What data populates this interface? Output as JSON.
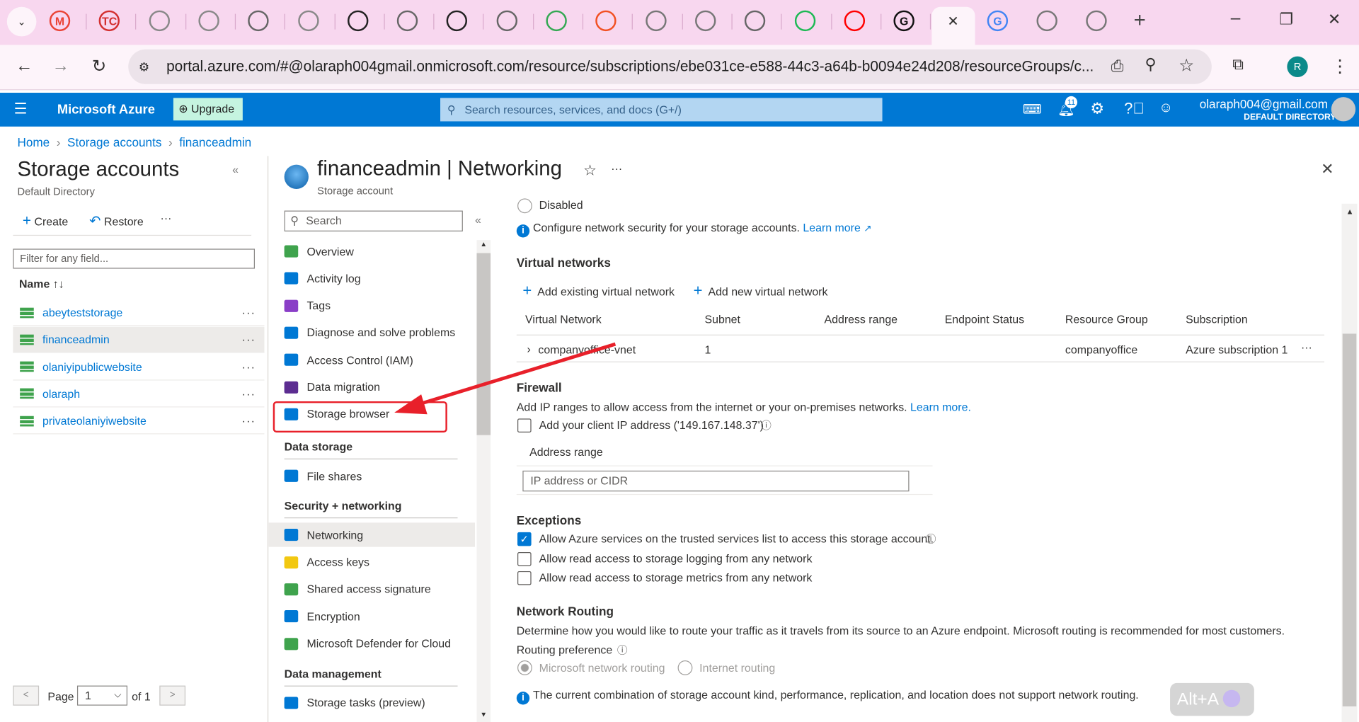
{
  "browser": {
    "tabs": [
      {
        "icon": "gmail-icon",
        "label": "M"
      },
      {
        "icon": "tc-icon",
        "label": "TC"
      },
      {
        "icon": "copilot-icon"
      },
      {
        "icon": "copilot-icon"
      },
      {
        "icon": "chatgpt-icon"
      },
      {
        "icon": "copilot-icon"
      },
      {
        "icon": "github-icon"
      },
      {
        "icon": "chatgpt-icon"
      },
      {
        "icon": "github-icon"
      },
      {
        "icon": "chatgpt-icon"
      },
      {
        "icon": "chrome-icon"
      },
      {
        "icon": "microsoft-icon"
      },
      {
        "icon": "site-icon"
      },
      {
        "icon": "site-icon"
      },
      {
        "icon": "chatgpt-icon"
      },
      {
        "icon": "check-icon"
      },
      {
        "icon": "youtube-icon"
      },
      {
        "icon": "grammarly-icon",
        "label": "G"
      }
    ],
    "active_tab_close": "✕",
    "tabs_after": [
      {
        "icon": "google-icon",
        "label": "G"
      },
      {
        "icon": "site-icon"
      },
      {
        "icon": "site-icon"
      }
    ],
    "new_tab": "+",
    "url": "portal.azure.com/#@olaraph004gmail.onmicrosoft.com/resource/subscriptions/ebe031ce-e588-44c3-a64b-b0094e24d208/resourceGroups/c...",
    "profile_initial": "R"
  },
  "azure": {
    "brand": "Microsoft Azure",
    "upgrade": "Upgrade",
    "search_placeholder": "Search resources, services, and docs (G+/)",
    "notifications": "11",
    "user": "olaraph004@gmail.com",
    "directory": "DEFAULT DIRECTORY",
    "accent": "#0078d4"
  },
  "breadcrumb": [
    "Home",
    "Storage accounts",
    "financeadmin"
  ],
  "left": {
    "title": "Storage accounts",
    "subtitle": "Default Directory",
    "create": "Create",
    "restore": "Restore",
    "filter_placeholder": "Filter for any field...",
    "col_name": "Name ↑↓",
    "accounts": [
      "abeyteststorage",
      "financeadmin",
      "olaniyipublicwebsite",
      "olaraph",
      "privateolaniyiwebsite"
    ],
    "selected": "financeadmin",
    "page_label": "Page",
    "page_value": "1",
    "of_label": "of 1"
  },
  "resource": {
    "title": "financeadmin | Networking",
    "subtitle": "Storage account",
    "menu_search": "Search",
    "menu": [
      {
        "label": "Overview",
        "color": "#3fa34d"
      },
      {
        "label": "Activity log",
        "color": "#0078d4"
      },
      {
        "label": "Tags",
        "color": "#8a3ec7"
      },
      {
        "label": "Diagnose and solve problems",
        "color": "#0078d4"
      },
      {
        "label": "Access Control (IAM)",
        "color": "#0078d4"
      },
      {
        "label": "Data migration",
        "color": "#5c2d91"
      },
      {
        "label": "Storage browser",
        "color": "#0078d4"
      }
    ],
    "sections": [
      {
        "title": "Data storage",
        "items": [
          {
            "label": "File shares",
            "color": "#0078d4"
          }
        ]
      },
      {
        "title": "Security + networking",
        "items": [
          {
            "label": "Networking",
            "color": "#0078d4"
          },
          {
            "label": "Access keys",
            "color": "#f2c811"
          },
          {
            "label": "Shared access signature",
            "color": "#3fa34d"
          },
          {
            "label": "Encryption",
            "color": "#0078d4"
          },
          {
            "label": "Microsoft Defender for Cloud",
            "color": "#3fa34d"
          }
        ]
      },
      {
        "title": "Data management",
        "items": [
          {
            "label": "Storage tasks (preview)",
            "color": "#0078d4"
          }
        ]
      }
    ],
    "selected_menu": "Networking"
  },
  "content": {
    "disabled_option": "Disabled",
    "configure_info": "Configure network security for your storage accounts.",
    "learn_more": "Learn more",
    "vnet_title": "Virtual networks",
    "add_existing": "Add existing virtual network",
    "add_new": "Add new virtual network",
    "columns": [
      "Virtual Network",
      "Subnet",
      "Address range",
      "Endpoint Status",
      "Resource Group",
      "Subscription"
    ],
    "rows": [
      [
        "companyoffice-vnet",
        "1",
        "",
        "",
        "companyoffice",
        "Azure subscription 1"
      ]
    ],
    "firewall_title": "Firewall",
    "firewall_desc": "Add IP ranges to allow access from the internet or your on-premises networks.",
    "firewall_learn": "Learn more.",
    "client_ip": "Add your client IP address ('149.167.148.37')",
    "address_range": "Address range",
    "ip_placeholder": "IP address or CIDR",
    "exceptions_title": "Exceptions",
    "exceptions": [
      {
        "label": "Allow Azure services on the trusted services list to access this storage account.",
        "checked": true
      },
      {
        "label": "Allow read access to storage logging from any network",
        "checked": false
      },
      {
        "label": "Allow read access to storage metrics from any network",
        "checked": false
      }
    ],
    "routing_title": "Network Routing",
    "routing_desc": "Determine how you would like to route your traffic as it travels from its source to an Azure endpoint. Microsoft routing is recommended for most customers.",
    "routing_pref": "Routing preference",
    "routing_options": [
      "Microsoft network routing",
      "Internet routing"
    ],
    "routing_info": "The current combination of storage account kind, performance, replication, and location does not support network routing."
  },
  "overlay": {
    "shortcut": "Alt+A",
    "annotation_color": "#e8202a"
  }
}
